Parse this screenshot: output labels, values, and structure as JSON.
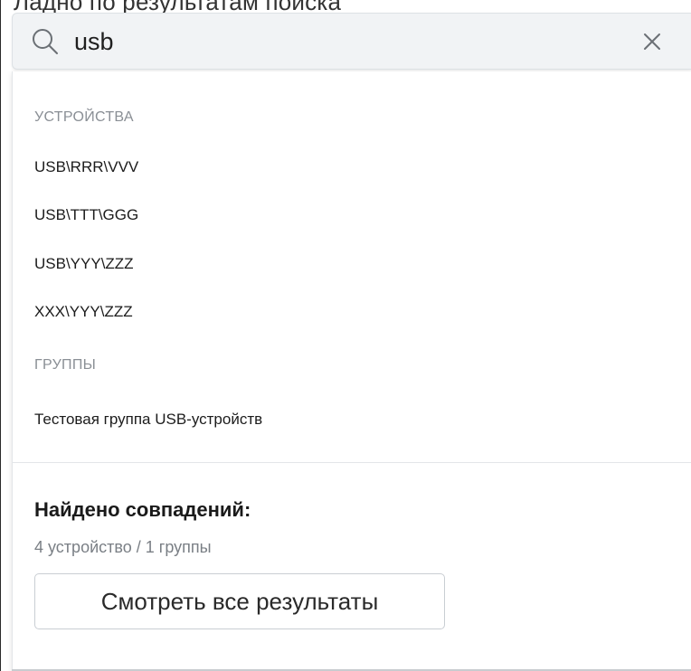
{
  "page_heading_partial": "Ладно по результатам поиска",
  "search": {
    "value": "usb",
    "placeholder": ""
  },
  "icons": {
    "search": "search-icon",
    "clear": "close-icon"
  },
  "devices": {
    "heading": "УСТРОЙСТВА",
    "items": [
      {
        "label": "USB\\RRR\\VVV"
      },
      {
        "label": "USB\\TTT\\GGG"
      },
      {
        "label": "USB\\YYY\\ZZZ"
      },
      {
        "label": "XXX\\YYY\\ZZZ"
      }
    ]
  },
  "groups": {
    "heading": "ГРУППЫ",
    "items": [
      {
        "label": "Тестовая группа USB-устройств"
      }
    ]
  },
  "summary": {
    "title": "Найдено совпадений:",
    "counts": "4 устройство / 1 группы",
    "button_label": "Смотреть все результаты"
  },
  "colors": {
    "search_bar_bg": "#f1f3f5",
    "heading_text": "#8a8f95",
    "item_text": "#1c1c1c"
  }
}
